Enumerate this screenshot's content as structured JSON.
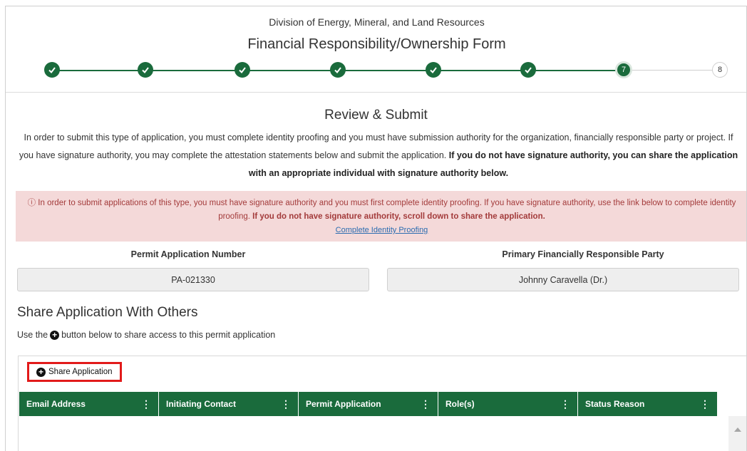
{
  "header": {
    "division": "Division of Energy, Mineral, and Land Resources",
    "title": "Financial Responsibility/Ownership Form"
  },
  "stepper": {
    "steps": [
      {
        "state": "complete",
        "label": ""
      },
      {
        "state": "complete",
        "label": ""
      },
      {
        "state": "complete",
        "label": ""
      },
      {
        "state": "complete",
        "label": ""
      },
      {
        "state": "complete",
        "label": ""
      },
      {
        "state": "complete",
        "label": ""
      },
      {
        "state": "current",
        "label": "7"
      },
      {
        "state": "upcoming",
        "label": "8"
      }
    ],
    "accent_color": "#1a6b3c"
  },
  "review": {
    "title": "Review & Submit",
    "intro_text": "In order to submit this type of application, you must complete identity proofing and you must have submission authority for the organization, financially responsible party or project. If you have signature authority, you may complete the attestation statements below and submit the application.",
    "intro_bold": "If you do not have signature authority, you can share the application with an appropriate individual with signature authority below."
  },
  "alert": {
    "icon": "info-circle-icon",
    "text": "In order to submit applications of this type, you must have signature authority and you must first complete identity proofing. If you have signature authority, use the link below to complete identity proofing.",
    "bold": "If you do not have signature authority, scroll down to share the application.",
    "link": "Complete Identity Proofing",
    "bg_color": "#f4d9d9"
  },
  "fields": {
    "permit_label": "Permit Application Number",
    "permit_value": "PA-021330",
    "party_label": "Primary Financially Responsible Party",
    "party_value": "Johnny Caravella (Dr.)"
  },
  "share": {
    "title": "Share Application With Others",
    "help_prefix": "Use the",
    "help_suffix": "button below to share access to this permit application",
    "button_label": "Share Application"
  },
  "table": {
    "columns": [
      "Email Address",
      "Initiating Contact",
      "Permit Application",
      "Role(s)",
      "Status Reason"
    ],
    "rows": []
  }
}
